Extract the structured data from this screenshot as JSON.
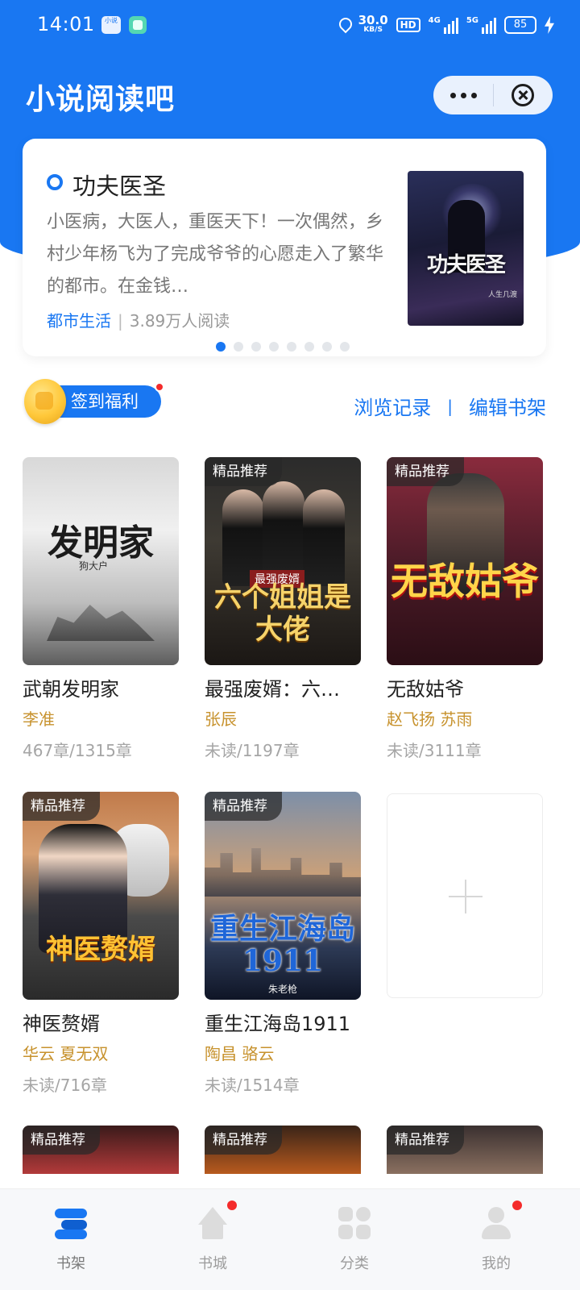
{
  "status_bar": {
    "time": "14:01",
    "mini_app_label": "小说",
    "net_speed_value": "30.0",
    "net_speed_unit": "KB/S",
    "hd_label": "HD",
    "signal1_label": "4G",
    "signal2_label": "5G",
    "battery": "85"
  },
  "header": {
    "title": "小说阅读吧",
    "colors": {
      "primary": "#1977f2"
    }
  },
  "featured": {
    "title": "功夫医圣",
    "description": "小医病，大医人，重医天下！一次偶然，乡村少年杨飞为了完成爷爷的心愿走入了繁华的都市。在金钱…",
    "category": "都市生活",
    "readers": "3.89万人阅读",
    "cover_title": "功夫医圣",
    "cover_author": "人生几渡",
    "page_count": 8,
    "current_page": 0
  },
  "actions": {
    "checkin_label": "签到福利",
    "history_label": "浏览记录",
    "separator": "|",
    "edit_label": "编辑书架"
  },
  "books": [
    {
      "title": "武朝发明家",
      "author": "李准",
      "progress": "467章/1315章",
      "badge": "",
      "cover_text": "发明家",
      "cover_sub": "狗大户"
    },
    {
      "title": "最强废婿：六…",
      "author": "张辰",
      "progress": "未读/1197章",
      "badge": "精品推荐",
      "cover_text": "六个姐姐是大佬",
      "cover_sub": "最强废婿"
    },
    {
      "title": "无敌姑爷",
      "author": "赵飞扬 苏雨",
      "progress": "未读/3111章",
      "badge": "精品推荐",
      "cover_text": "无敌姑爷"
    },
    {
      "title": "神医赘婿",
      "author": "华云 夏无双",
      "progress": "未读/716章",
      "badge": "精品推荐",
      "cover_text": "神医赘婿"
    },
    {
      "title": "重生江海岛1911",
      "author": "陶昌 骆云",
      "progress": "未读/1514章",
      "badge": "精品推荐",
      "cover_text": "重生江海岛1911",
      "cover_sub": "朱老枪"
    }
  ],
  "peek_badges": [
    "精品推荐",
    "精品推荐",
    "精品推荐"
  ],
  "tabbar": {
    "items": [
      {
        "label": "书架",
        "icon": "bookshelf-icon",
        "active": true,
        "dot": false
      },
      {
        "label": "书城",
        "icon": "home-icon",
        "active": false,
        "dot": true
      },
      {
        "label": "分类",
        "icon": "category-icon",
        "active": false,
        "dot": false
      },
      {
        "label": "我的",
        "icon": "profile-icon",
        "active": false,
        "dot": true
      }
    ]
  }
}
